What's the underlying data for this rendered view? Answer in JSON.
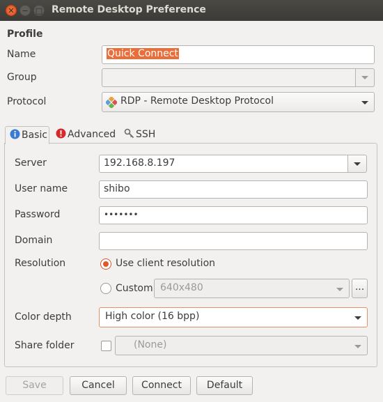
{
  "window": {
    "title": "Remote Desktop Preference"
  },
  "profile": {
    "heading": "Profile",
    "name_label": "Name",
    "name_value": "Quick Connect",
    "group_label": "Group",
    "group_value": "",
    "protocol_label": "Protocol",
    "protocol_value": "RDP - Remote Desktop Protocol"
  },
  "tabs": [
    {
      "label": "Basic",
      "icon": "info-icon"
    },
    {
      "label": "Advanced",
      "icon": "warning-icon"
    },
    {
      "label": "SSH",
      "icon": "key-icon"
    }
  ],
  "basic": {
    "server_label": "Server",
    "server_value": "192.168.8.197",
    "username_label": "User name",
    "username_value": "shibo",
    "password_label": "Password",
    "password_value": "•••••••",
    "domain_label": "Domain",
    "domain_value": "",
    "resolution_label": "Resolution",
    "resolution_client": "Use client resolution",
    "resolution_custom": "Custom",
    "custom_value": "640x480",
    "more_button": "...",
    "color_depth_label": "Color depth",
    "color_depth_value": "High color (16 bpp)",
    "share_folder_label": "Share folder",
    "share_folder_value": "(None)"
  },
  "buttons": {
    "save": "Save",
    "cancel": "Cancel",
    "connect": "Connect",
    "default": "Default"
  },
  "colors": {
    "accent": "#e0592c",
    "titlebar": "#3c3b37"
  }
}
